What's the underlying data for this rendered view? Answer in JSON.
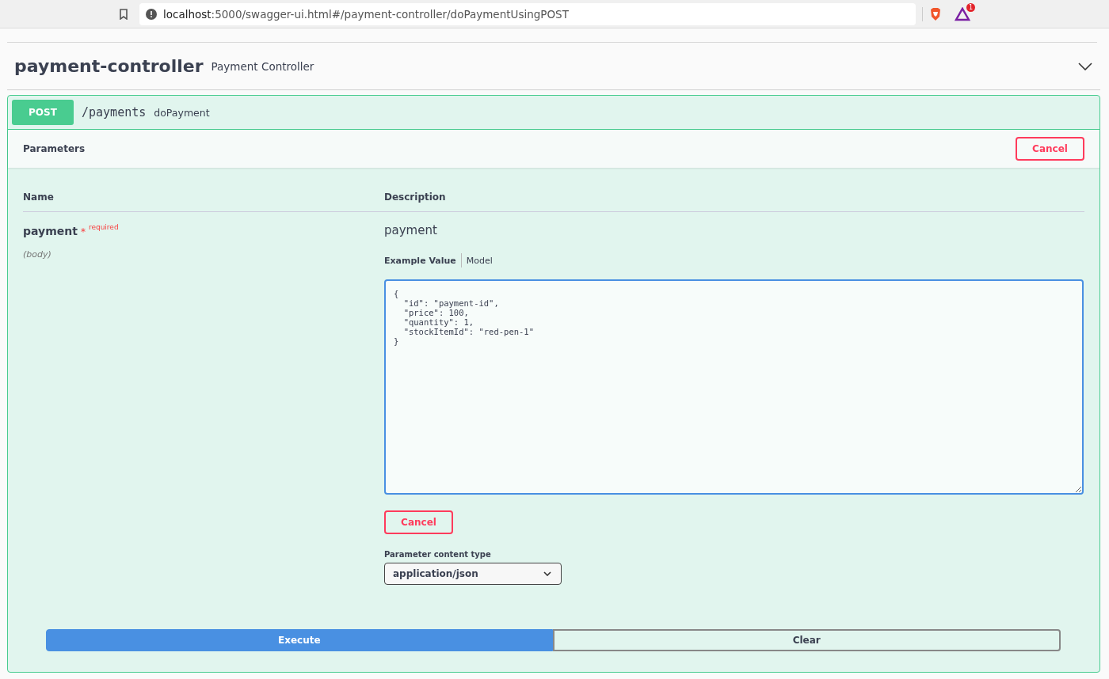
{
  "browser": {
    "url_host": "localhost",
    "url_rest": ":5000/swagger-ui.html#/payment-controller/doPaymentUsingPOST",
    "badge": "1"
  },
  "tag": {
    "name": "payment-controller",
    "description": "Payment Controller",
    "expanded": true
  },
  "operation": {
    "method": "POST",
    "path": "/payments",
    "summary": "doPayment",
    "parameters_title": "Parameters",
    "cancel_top": "Cancel",
    "columns": [
      "Name",
      "Description"
    ],
    "parameter": {
      "name": "payment",
      "required_mark": "*",
      "required": "required",
      "location": "(body)",
      "description": "payment",
      "tabs": [
        {
          "label": "Example Value",
          "selected": true
        },
        {
          "label": "Model",
          "selected": false
        }
      ],
      "body": "{\n  \"id\": \"payment-id\",\n  \"price\": 100,\n  \"quantity\": 1,\n  \"stockItemId\": \"red-pen-1\"\n}",
      "cancel": "Cancel",
      "content_type_label": "Parameter content type",
      "content_type": "application/json"
    },
    "execute": "Execute",
    "clear": "Clear"
  }
}
